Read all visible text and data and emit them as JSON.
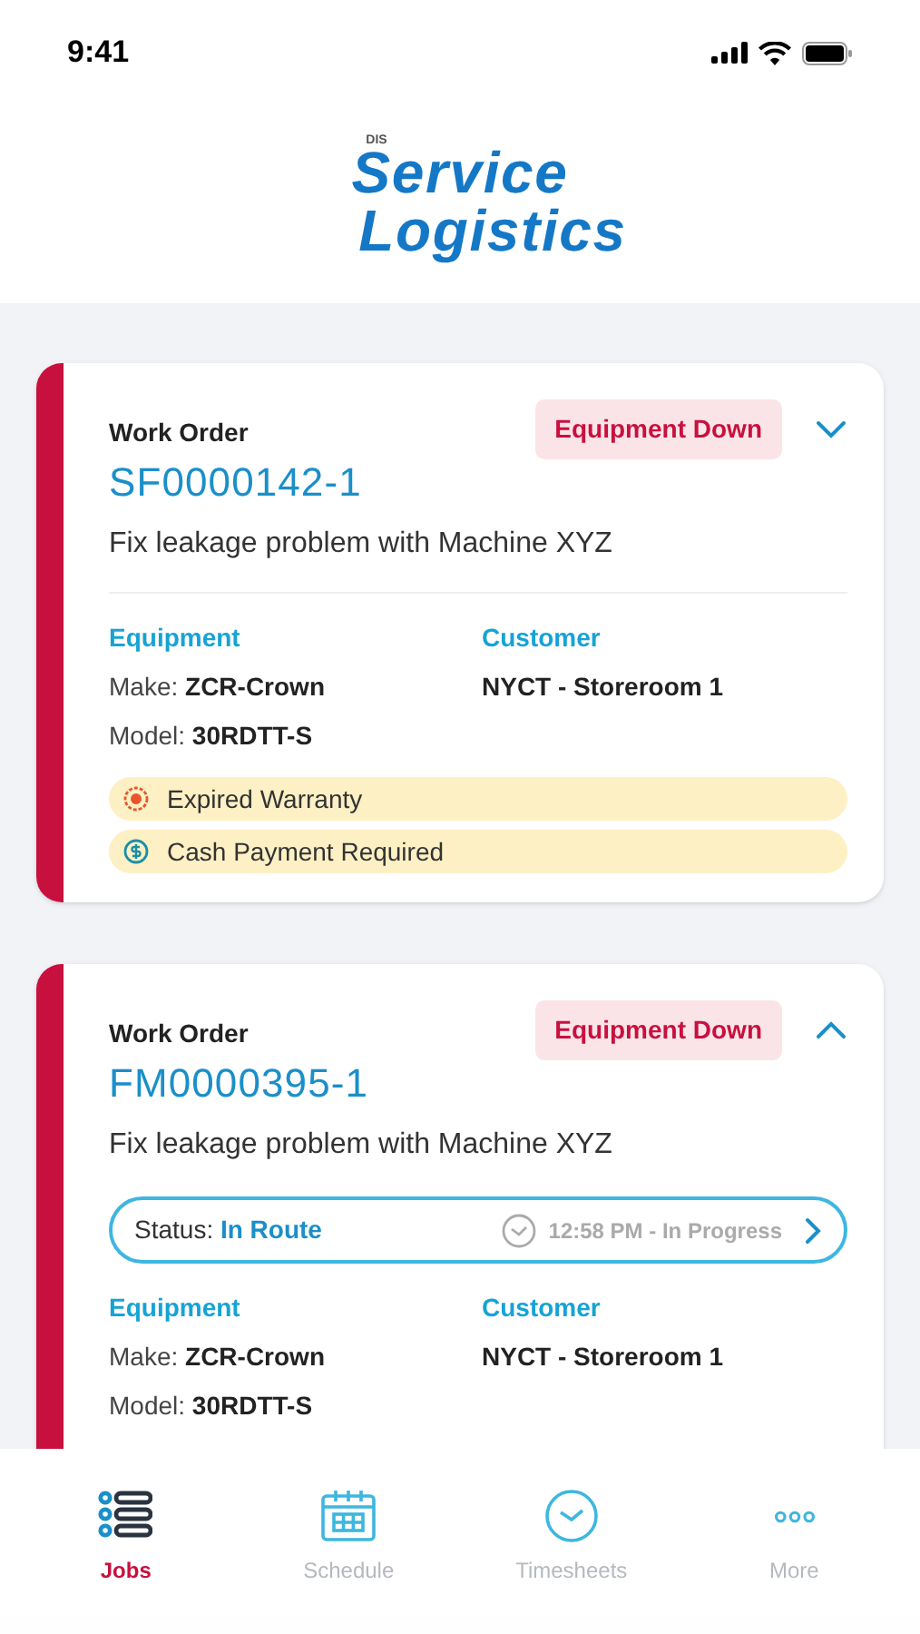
{
  "status_bar": {
    "time": "9:41"
  },
  "logo": {
    "small": "DIS",
    "line_1": "Service",
    "line_2": "Logistics"
  },
  "work_orders": [
    {
      "label": "Work Order",
      "number": "SF0000142-1",
      "priority": "Equipment Down",
      "expanded": false,
      "description": "Fix leakage problem with Machine XYZ",
      "equipment_label": "Equipment",
      "make_label": "Make:",
      "make": "ZCR-Crown",
      "model_label": "Model:",
      "model": "30RDTT-S",
      "customer_label": "Customer",
      "customer": "NYCT - Storeroom 1",
      "alerts": [
        {
          "kind": "warranty",
          "text": "Expired Warranty"
        },
        {
          "kind": "cash",
          "text": "Cash Payment Required"
        }
      ]
    },
    {
      "label": "Work Order",
      "number": "FM0000395-1",
      "priority": "Equipment Down",
      "expanded": true,
      "description": "Fix leakage problem with Machine XYZ",
      "status": {
        "label": "Status:",
        "value": "In Route",
        "time": "12:58 PM - In Progress"
      },
      "equipment_label": "Equipment",
      "make_label": "Make:",
      "make": "ZCR-Crown",
      "model_label": "Model:",
      "model": "30RDTT-S",
      "customer_label": "Customer",
      "customer": "NYCT - Storeroom 1"
    }
  ],
  "tab_bar": [
    {
      "kind": "jobs",
      "label": "Jobs",
      "selected": true
    },
    {
      "kind": "schedule",
      "label": "Schedule",
      "selected": false
    },
    {
      "kind": "timesheets",
      "label": "Timesheets",
      "selected": false
    },
    {
      "kind": "more",
      "label": "More",
      "selected": false
    }
  ]
}
